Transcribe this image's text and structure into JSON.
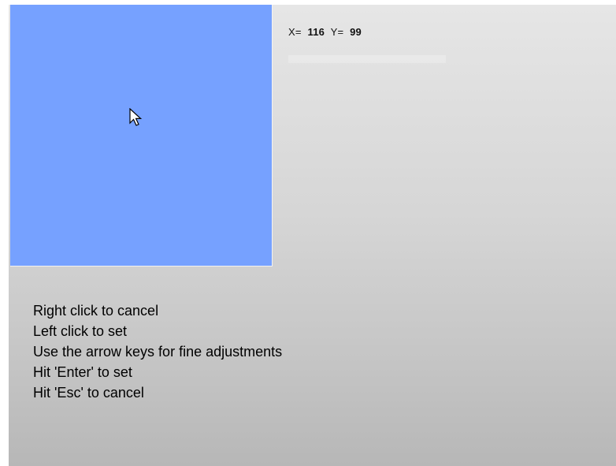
{
  "readout": {
    "x_label": "X=",
    "x_value": "116",
    "y_label": "Y=",
    "y_value": "99"
  },
  "instructions": [
    "Right click to cancel",
    "Left click to set",
    "Use the arrow keys for fine adjustments",
    "Hit 'Enter' to set",
    "Hit 'Esc' to cancel"
  ],
  "icons": {
    "cursor": "mouse-pointer-icon"
  },
  "colors": {
    "preview": "#76a1ff",
    "panel_top": "#e6e6e6",
    "panel_bottom": "#b7b7b7",
    "text": "#000000"
  }
}
